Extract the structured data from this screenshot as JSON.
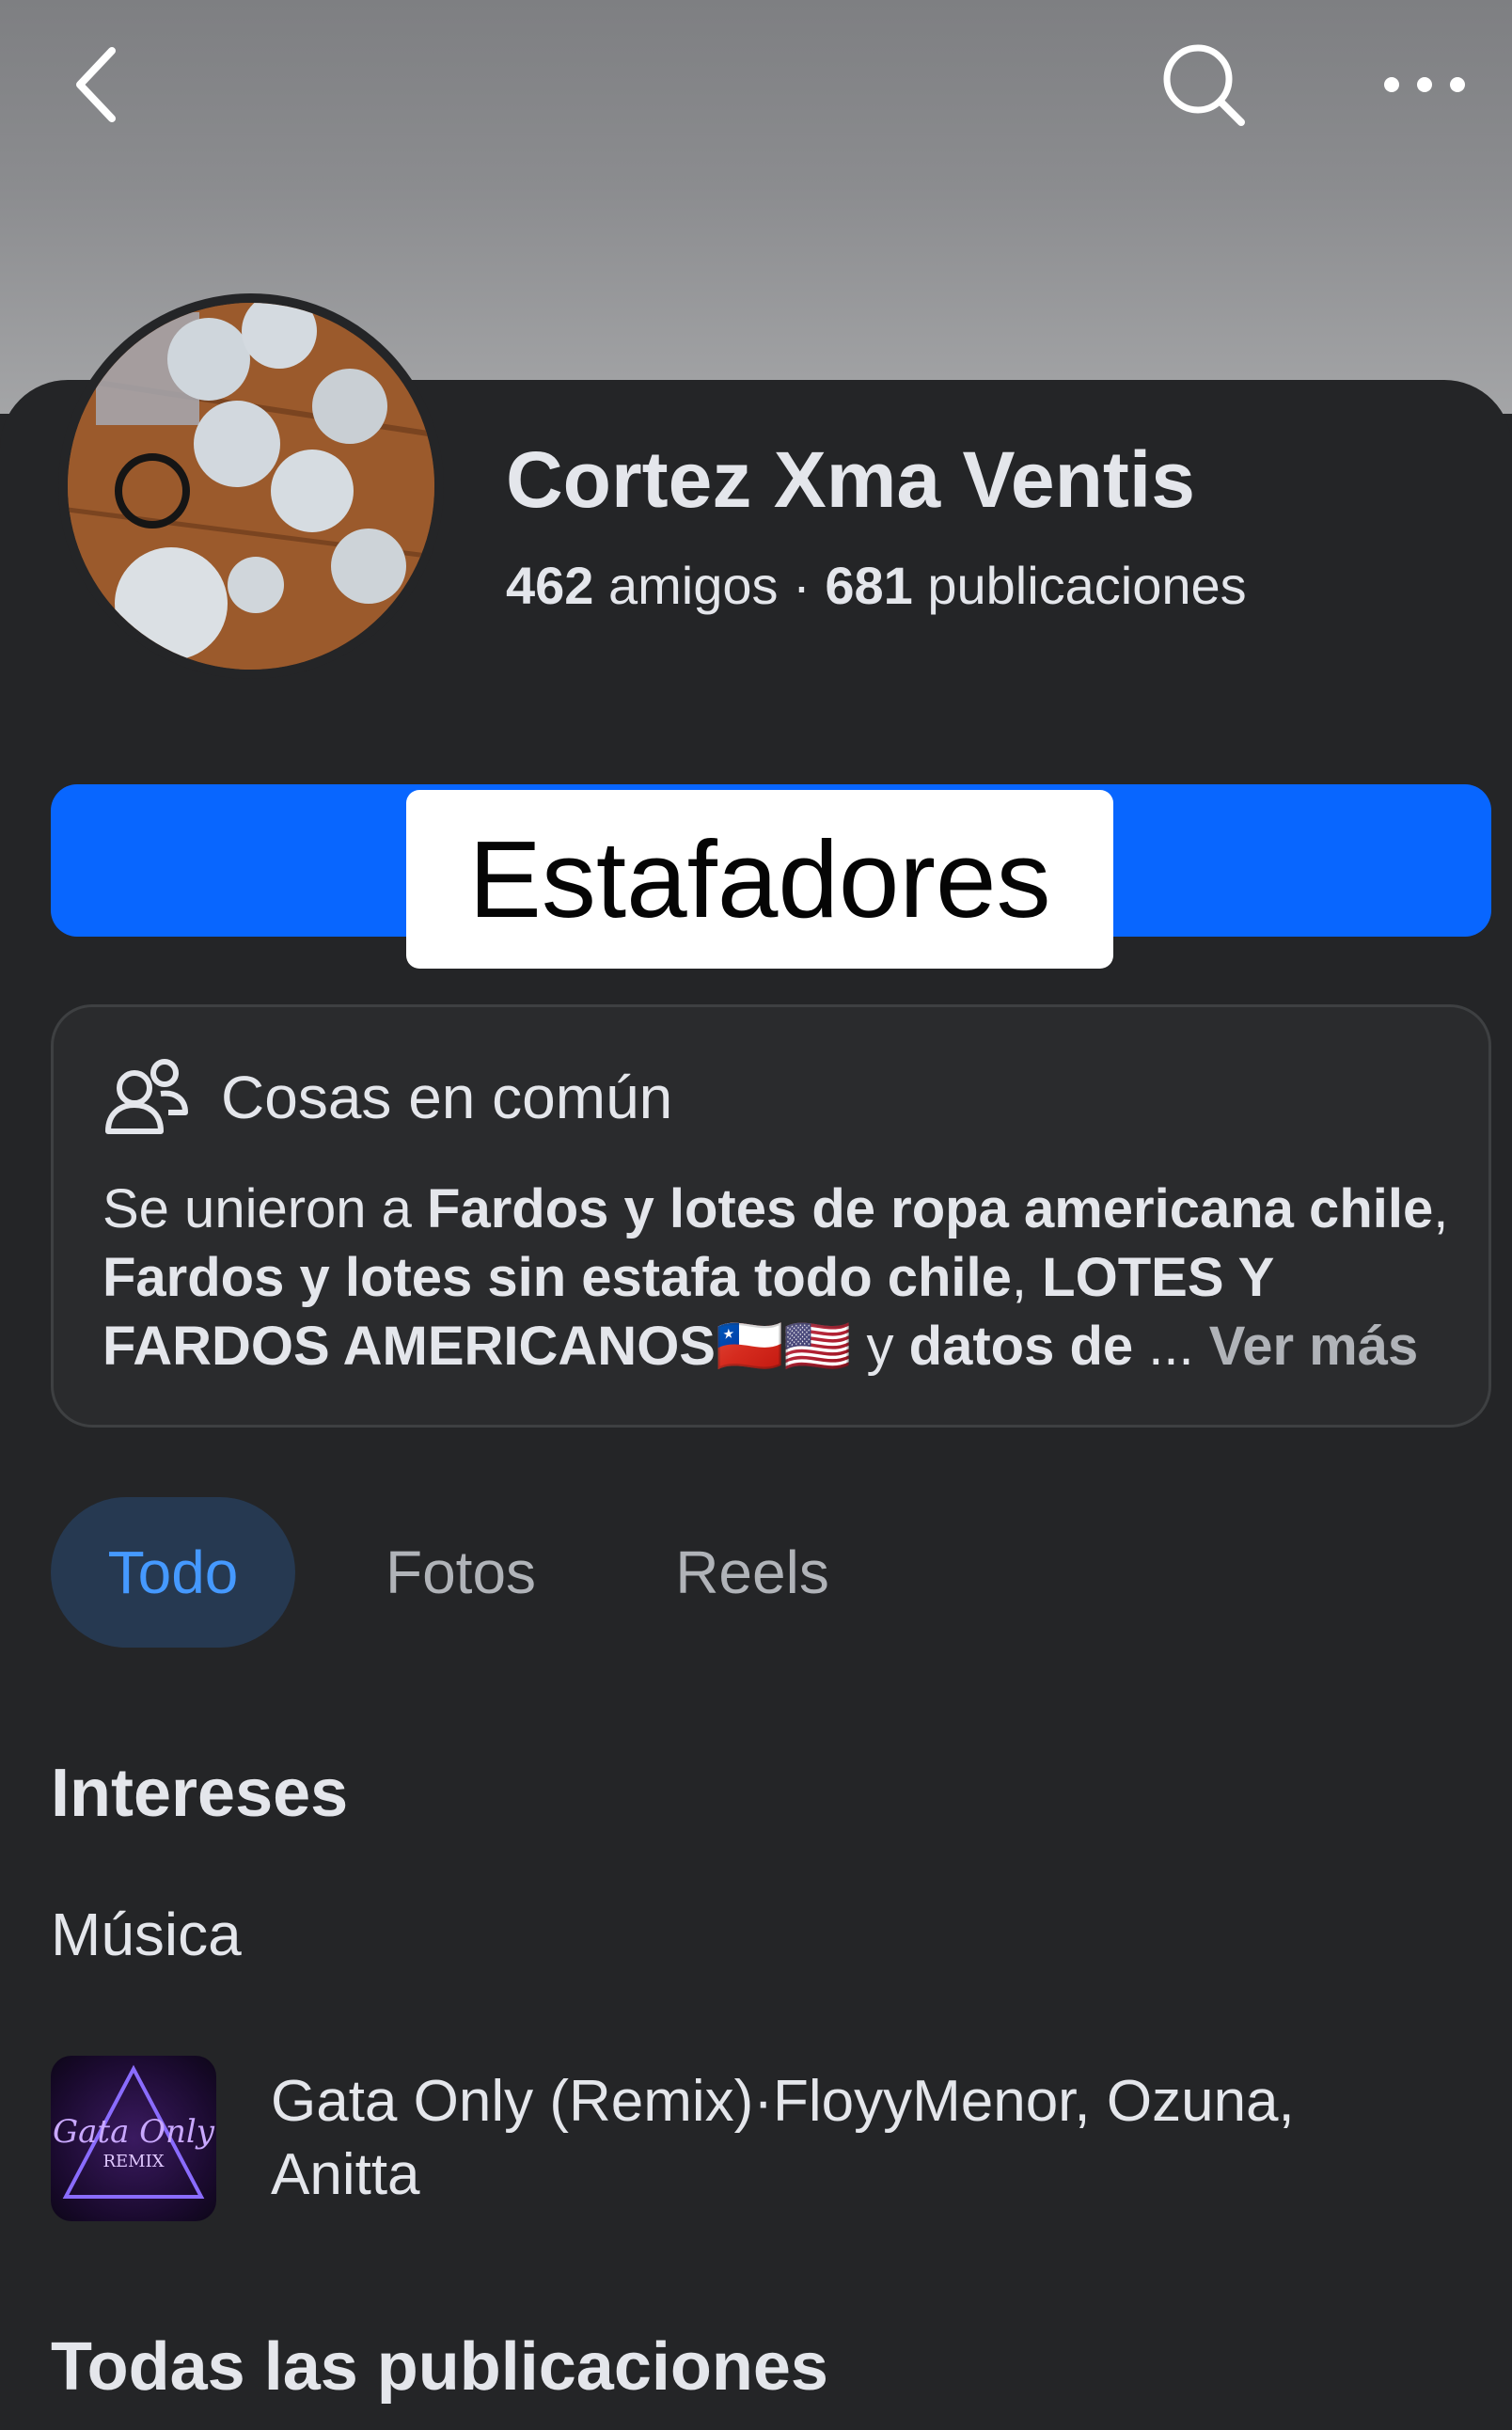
{
  "header": {
    "back_icon": "chevron-left-icon",
    "search_icon": "search-icon",
    "more_icon": "more-horizontal-icon"
  },
  "profile": {
    "name": "Cortez Xma Ventis",
    "friends_count": "462",
    "friends_label": "amigos",
    "separator": "·",
    "posts_count": "681",
    "posts_label": "publicaciones"
  },
  "overlay_label": "Estafadores",
  "common": {
    "title": "Cosas en común",
    "prefix": "Se unieron a ",
    "group1": "Fardos y lotes de ropa americana chile",
    "sep1": ", ",
    "group2": "Fardos y lotes sin estafa todo chile",
    "sep2": ", ",
    "group3": "LOTES Y FARDOS AMERICANOS🇨🇱🇺🇸",
    "conj": " y ",
    "group4": "datos de",
    "ellipsis": " ... ",
    "see_more": "Ver más"
  },
  "tabs": [
    {
      "label": "Todo",
      "active": true
    },
    {
      "label": "Fotos",
      "active": false
    },
    {
      "label": "Reels",
      "active": false
    }
  ],
  "interests": {
    "title": "Intereses",
    "category": "Música",
    "song": "Gata Only (Remix)·FloyyMenor, Ozuna, Anitta",
    "album_art_text": "Gata Only",
    "album_art_sub": "REMIX"
  },
  "posts_section_title": "Todas las publicaciones",
  "colors": {
    "background": "#242527",
    "accent_blue": "#0866ff",
    "active_tab_bg": "#263951",
    "active_tab_text": "#4599ff",
    "muted_text": "#b0b3b8"
  }
}
